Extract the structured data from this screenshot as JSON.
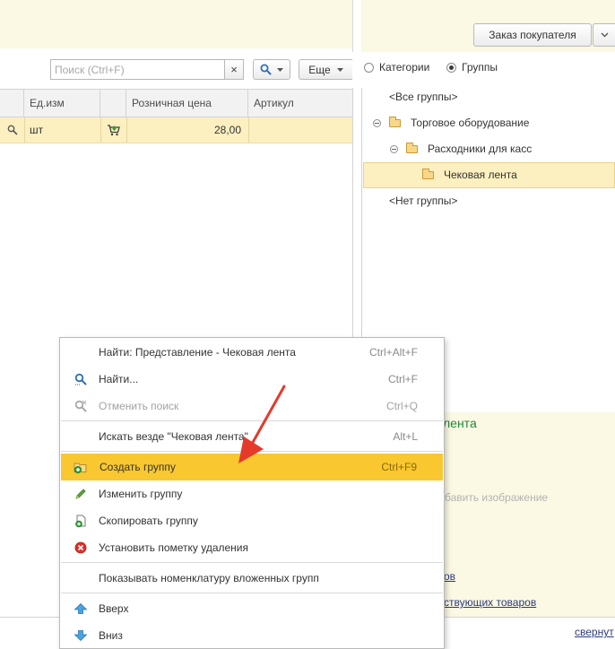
{
  "toolbar": {
    "order_button_label": "Заказ покупателя",
    "search_placeholder": "Поиск (Ctrl+F)",
    "clear_symbol": "×",
    "more_label": "Еще"
  },
  "filter": {
    "options": [
      {
        "label": "Категории",
        "selected": false
      },
      {
        "label": "Группы",
        "selected": true
      }
    ]
  },
  "table": {
    "columns": [
      "Ед.изм",
      "Розничная цена",
      "Артикул"
    ],
    "rows": [
      {
        "unit": "шт",
        "price": "28,00",
        "article": ""
      }
    ]
  },
  "tree": {
    "items": [
      {
        "label": "<Все группы>"
      },
      {
        "label": "Торговое оборудование"
      },
      {
        "label": "Расходники для касс"
      },
      {
        "label": "Чековая лента",
        "selected": true
      },
      {
        "label": "<Нет группы>"
      }
    ]
  },
  "detail": {
    "title_fragment": "лента",
    "add_image_fragment": "бавить изображение",
    "link1_fragment": "ов",
    "link2_fragment": "ствующих товаров",
    "collapse_fragment": "свернут"
  },
  "context_menu": {
    "items": [
      {
        "label": "Найти: Представление - Чековая лента",
        "shortcut": "Ctrl+Alt+F"
      },
      {
        "label": "Найти...",
        "shortcut": "Ctrl+F",
        "icon": "search-icon"
      },
      {
        "label": "Отменить поиск",
        "shortcut": "Ctrl+Q",
        "icon": "cancel-search-icon",
        "disabled": true
      },
      {
        "label": "Искать везде \"Чековая лента\"",
        "shortcut": "Alt+L"
      },
      {
        "label": "Создать группу",
        "shortcut": "Ctrl+F9",
        "icon": "create-folder-icon",
        "highlighted": true
      },
      {
        "label": "Изменить группу",
        "icon": "pencil-icon"
      },
      {
        "label": "Скопировать группу",
        "icon": "copy-icon"
      },
      {
        "label": "Установить пометку удаления",
        "icon": "delete-mark-icon"
      },
      {
        "label": "Показывать номенклатуру вложенных групп"
      },
      {
        "label": "Вверх",
        "icon": "arrow-up-icon"
      },
      {
        "label": "Вниз",
        "icon": "arrow-down-icon"
      }
    ]
  },
  "colors": {
    "highlight": "#f9c72f",
    "selected_row": "#fcefc0",
    "panel_bg": "#fbf8e3",
    "arrow": "#e53a2b"
  }
}
